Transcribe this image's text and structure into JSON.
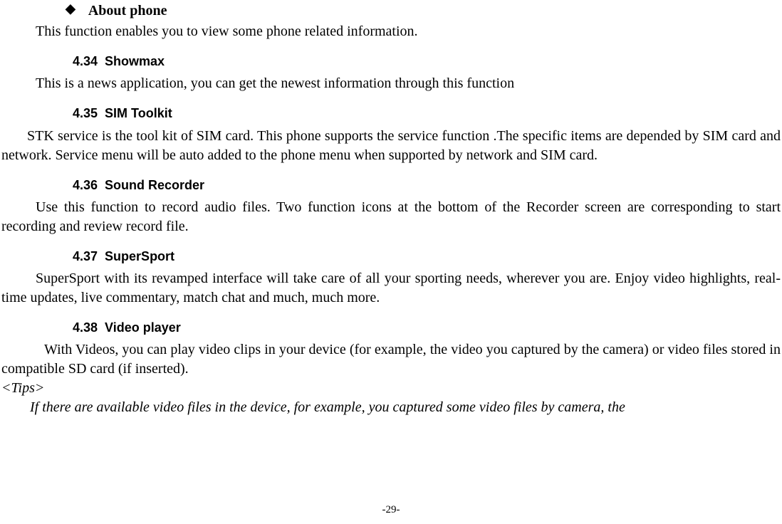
{
  "bullet": {
    "icon": "◆",
    "label": "About phone"
  },
  "intro": "This function enables you to view some phone related information.",
  "sections": {
    "s434": {
      "num": "4.34",
      "title": "Showmax",
      "body": "This is a news application, you can get the newest information through this function"
    },
    "s435": {
      "num": "4.35",
      "title": "SIM Toolkit",
      "body": "STK service is the tool kit of SIM card. This phone supports the service function .The specific items are depended by SIM card and network. Service menu will be auto added to the phone menu when supported by network and SIM card."
    },
    "s436": {
      "num": "4.36",
      "title": "Sound Recorder",
      "body": "Use this function to record audio files. Two function icons at the bottom of the Recorder screen are corresponding to start recording and review record file."
    },
    "s437": {
      "num": "4.37",
      "title": "SuperSport",
      "body": "SuperSport with its revamped interface will take care of all your sporting needs, wherever you are. Enjoy video highlights, real-time updates, live commentary, match chat and much, much more."
    },
    "s438": {
      "num": "4.38",
      "title": "Video player",
      "body": "With Videos, you can play video clips in your device (for example, the video you captured by the camera) or video files stored in compatible SD card (if inserted)."
    }
  },
  "tips": {
    "label": "<Tips>",
    "body": "If there are available video files in the device, for example, you captured some video files by camera, the"
  },
  "pageNumber": "-29-"
}
